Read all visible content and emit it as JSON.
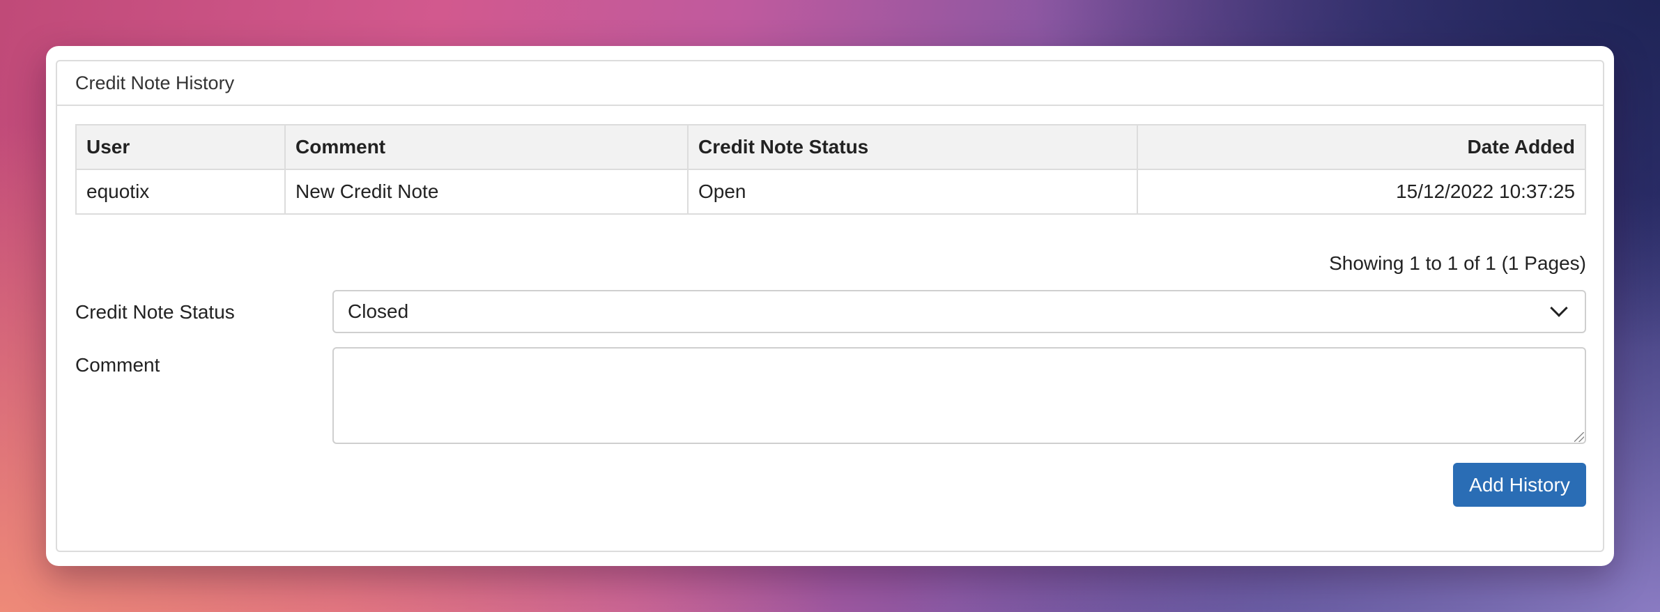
{
  "panel": {
    "title": "Credit Note History"
  },
  "table": {
    "headers": {
      "user": "User",
      "comment": "Comment",
      "status": "Credit Note Status",
      "date": "Date Added"
    },
    "rows": [
      {
        "user": "equotix",
        "comment": "New Credit Note",
        "status": "Open",
        "date": "15/12/2022 10:37:25"
      }
    ]
  },
  "pagination": {
    "text": "Showing 1 to 1 of 1 (1 Pages)"
  },
  "form": {
    "status_label": "Credit Note Status",
    "status_value": "Closed",
    "comment_label": "Comment",
    "comment_value": "",
    "submit_label": "Add History"
  },
  "colors": {
    "accent": "#2a6db5",
    "header_bg": "#f2f2f2",
    "border": "#dcdcdc"
  },
  "icons": {
    "select_arrow": "chevron-down-icon"
  }
}
